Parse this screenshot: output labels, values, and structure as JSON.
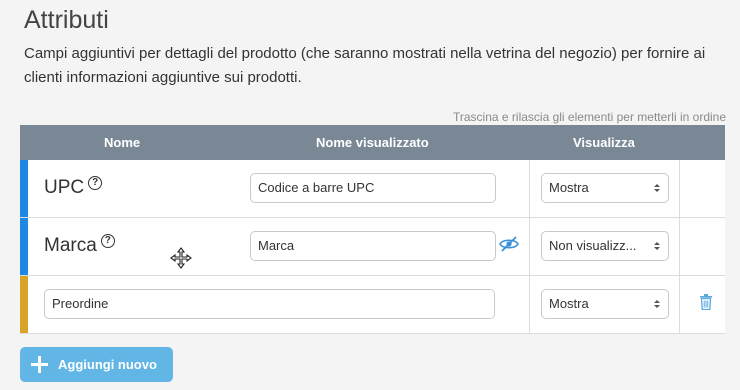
{
  "title": "Attributi",
  "description": "Campi aggiuntivi per dettagli del prodotto (che saranno mostrati nella vetrina del negozio) per fornire ai clienti informazioni aggiuntive sui prodotti.",
  "drag_hint": "Trascina e rilascia gli elementi per metterli in ordine",
  "table": {
    "headers": [
      "Nome",
      "Nome visualizzato",
      "Visualizza"
    ],
    "rows": [
      {
        "name": "UPC",
        "display_name": "Codice a barre UPC",
        "visibility": "Mostra",
        "accent": "#1e88e5"
      },
      {
        "name": "Marca",
        "display_name": "Marca",
        "visibility": "Non visualizz...",
        "accent": "#1e88e5"
      },
      {
        "name": "Preordine",
        "visibility": "Mostra",
        "accent": "#d9a328"
      }
    ]
  },
  "add_button": "Aggiungi nuovo",
  "colors": {
    "header_bg": "#7a8896",
    "button_bg": "#61b6e6",
    "icon_blue": "#1e88e5"
  }
}
